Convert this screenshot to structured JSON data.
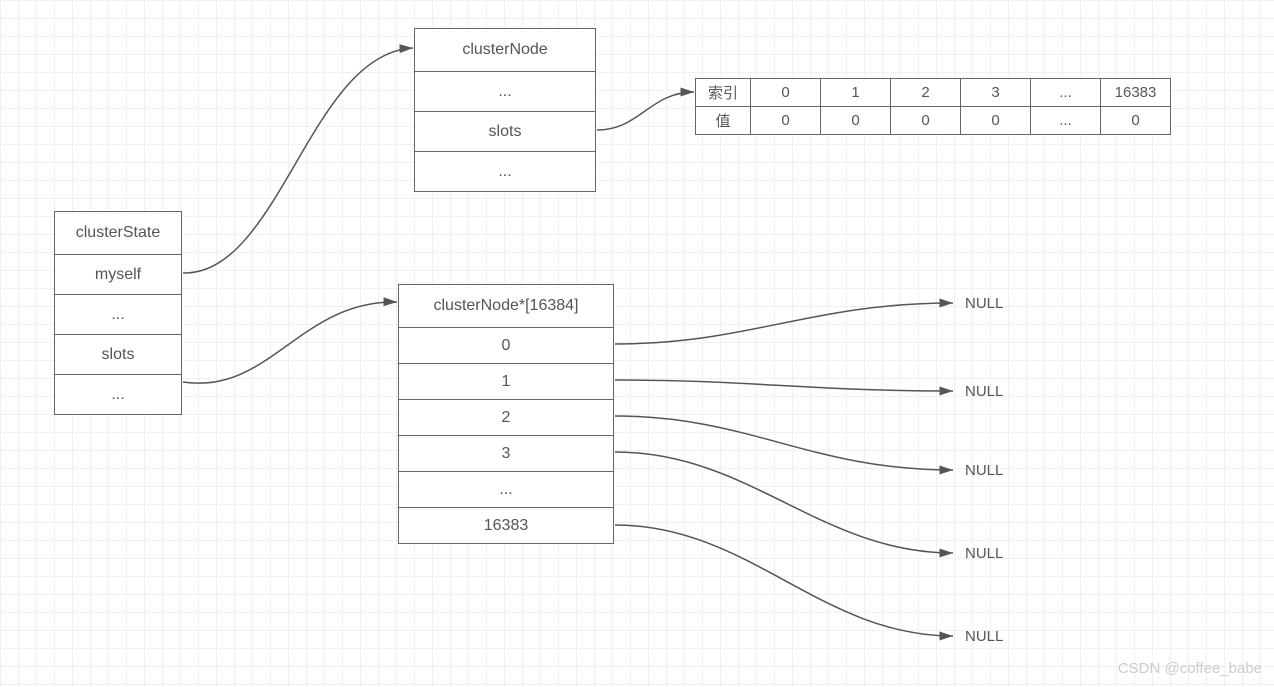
{
  "clusterState": {
    "title": "clusterState",
    "rows": [
      "myself",
      "...",
      "slots",
      "..."
    ]
  },
  "clusterNode": {
    "title": "clusterNode",
    "rows": [
      "...",
      "slots",
      "..."
    ]
  },
  "slotsTable": {
    "rowLabelIndex": "索引",
    "rowLabelValue": "值",
    "indices": [
      "0",
      "1",
      "2",
      "3",
      "...",
      "16383"
    ],
    "values": [
      "0",
      "0",
      "0",
      "0",
      "...",
      "0"
    ]
  },
  "clusterNodeArray": {
    "title": "clusterNode*[16384]",
    "rows": [
      "0",
      "1",
      "2",
      "3",
      "...",
      "16383"
    ]
  },
  "nulls": [
    "NULL",
    "NULL",
    "NULL",
    "NULL",
    "NULL"
  ],
  "watermark": "CSDN @coffee_babe"
}
